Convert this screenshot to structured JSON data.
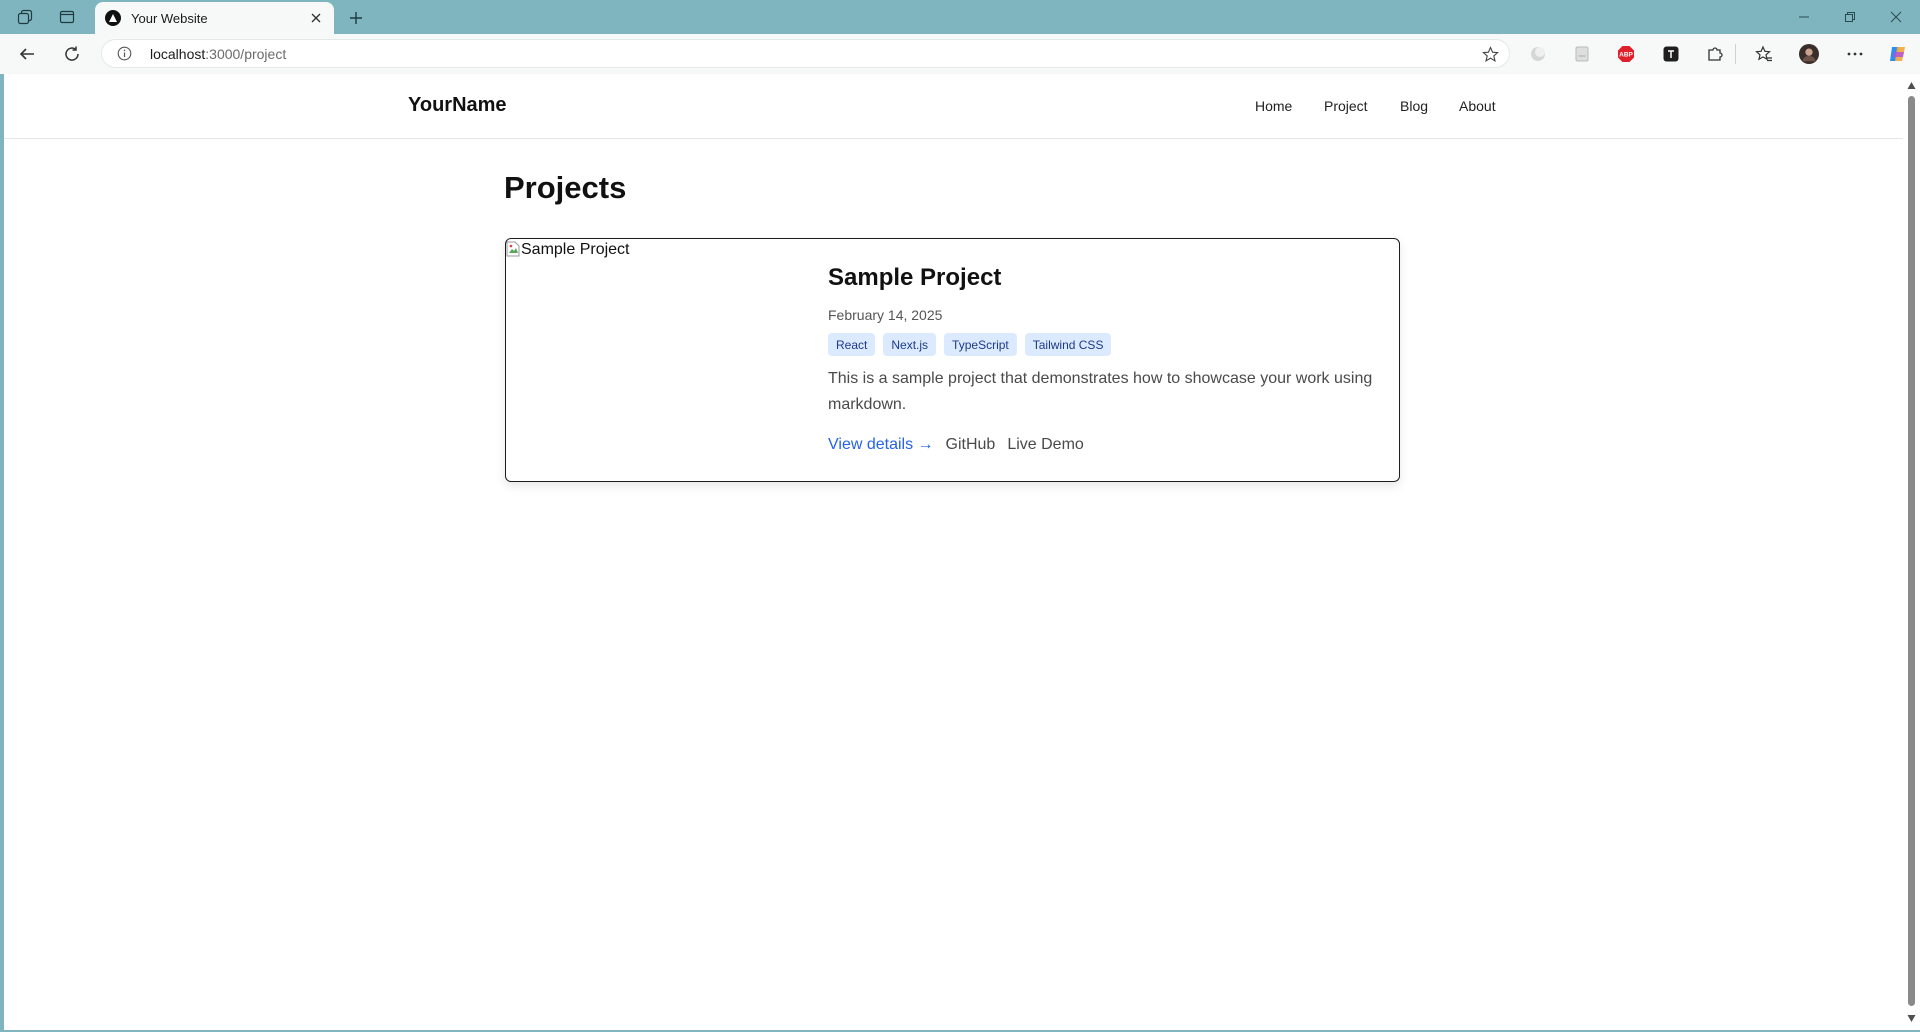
{
  "browser": {
    "tab_title": "Your Website",
    "url_host": "localhost",
    "url_path": ":3000/project"
  },
  "site": {
    "brand": "YourName",
    "nav": [
      "Home",
      "Project",
      "Blog",
      "About"
    ]
  },
  "page": {
    "title": "Projects"
  },
  "project": {
    "image_alt": "Sample Project",
    "title": "Sample Project",
    "date": "February 14, 2025",
    "tags": [
      "React",
      "Next.js",
      "TypeScript",
      "Tailwind CSS"
    ],
    "description": "This is a sample project that demonstrates how to showcase your work using markdown.",
    "link_details": "View details →",
    "link_github": "GitHub",
    "link_demo": "Live Demo"
  },
  "colors": {
    "chrome_accent": "#7fb5be",
    "link_blue": "#2563eb",
    "tag_bg": "#dbeafe",
    "tag_text": "#1e3a8a"
  },
  "icons": {
    "tab_actions": "collections-icon",
    "vertical_tabs": "vertical-tabs-icon",
    "site_favicon": "triangle-logo-icon",
    "extensions": [
      "profile-extension-icon",
      "reader-extension-icon",
      "adblock-extension-icon",
      "dev-extension-icon",
      "extensions-puzzle-icon",
      "favorites-icon",
      "avatar",
      "more-icon",
      "copilot-icon"
    ]
  }
}
